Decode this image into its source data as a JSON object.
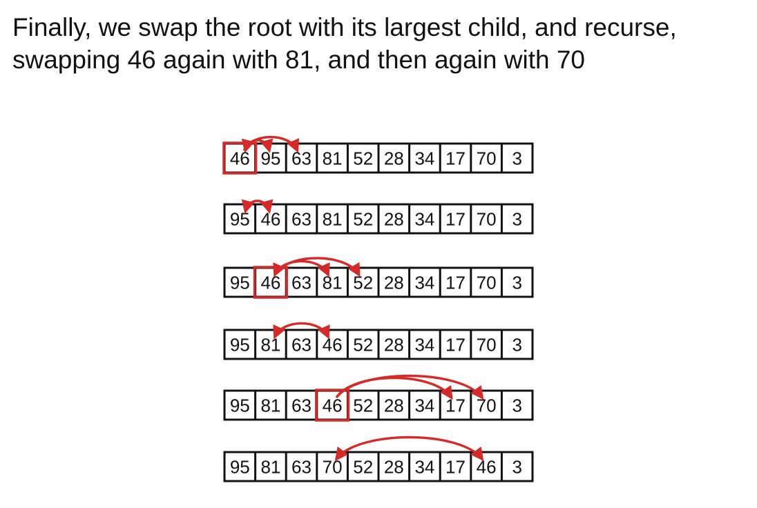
{
  "caption": {
    "line1": "Finally, we swap the root with its largest child, and recurse,",
    "line2": "swapping 46 again with 81, and then again with 70"
  },
  "colors": {
    "text": "#111111",
    "cell_border": "#111111",
    "highlight": "#d42a2a",
    "arrow": "#d42a2a"
  },
  "rows": [
    {
      "values": [
        "46",
        "95",
        "63",
        "81",
        "52",
        "28",
        "34",
        "17",
        "70",
        "3"
      ],
      "highlight_index": 0,
      "arrows": [
        {
          "from": 0,
          "to": 1,
          "style": "double-head"
        },
        {
          "from": 0,
          "to": 2,
          "style": "single-head"
        }
      ]
    },
    {
      "values": [
        "95",
        "46",
        "63",
        "81",
        "52",
        "28",
        "34",
        "17",
        "70",
        "3"
      ],
      "highlight_index": null,
      "arrows": [
        {
          "from": 0,
          "to": 1,
          "style": "swap"
        }
      ]
    },
    {
      "values": [
        "95",
        "46",
        "63",
        "81",
        "52",
        "28",
        "34",
        "17",
        "70",
        "3"
      ],
      "highlight_index": 1,
      "arrows": [
        {
          "from": 1,
          "to": 3,
          "style": "double-head"
        },
        {
          "from": 1,
          "to": 4,
          "style": "single-head"
        }
      ]
    },
    {
      "values": [
        "95",
        "81",
        "63",
        "46",
        "52",
        "28",
        "34",
        "17",
        "70",
        "3"
      ],
      "highlight_index": null,
      "arrows": [
        {
          "from": 1,
          "to": 3,
          "style": "swap"
        }
      ]
    },
    {
      "values": [
        "95",
        "81",
        "63",
        "46",
        "52",
        "28",
        "34",
        "17",
        "70",
        "3"
      ],
      "highlight_index": 3,
      "arrows": [
        {
          "from": 3,
          "to": 7,
          "style": "single-head"
        },
        {
          "from": 3,
          "to": 8,
          "style": "single-head"
        }
      ]
    },
    {
      "values": [
        "95",
        "81",
        "63",
        "70",
        "52",
        "28",
        "34",
        "17",
        "46",
        "3"
      ],
      "highlight_index": null,
      "arrows": [
        {
          "from": 3,
          "to": 8,
          "style": "swap"
        }
      ]
    }
  ]
}
